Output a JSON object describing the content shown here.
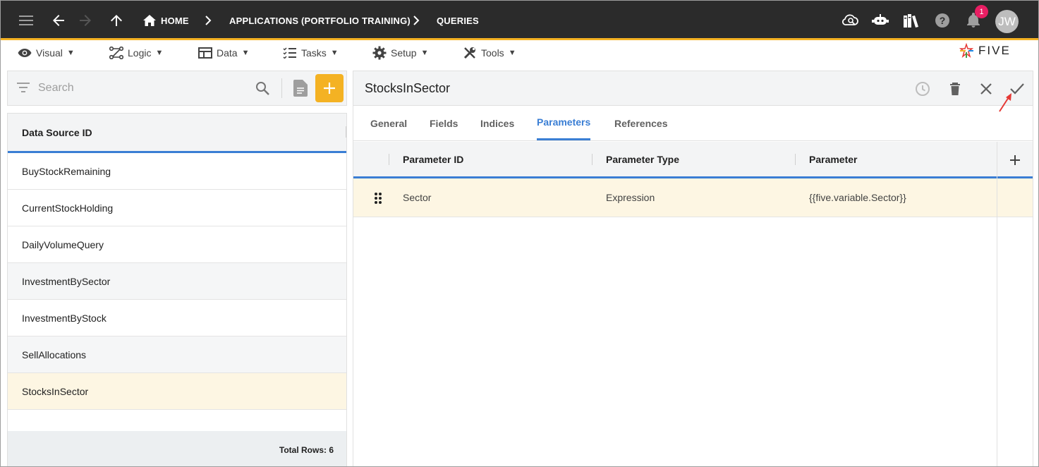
{
  "topbar": {
    "breadcrumbs": [
      "HOME",
      "APPLICATIONS (PORTFOLIO TRAINING)",
      "QUERIES"
    ],
    "notification_count": "1",
    "avatar_initials": "JW",
    "background_color": "#2b2b2b",
    "accent_color": "#f4b223",
    "icons": [
      "hamburger-menu-icon",
      "back-arrow-icon",
      "forward-arrow-icon",
      "up-arrow-icon",
      "home-icon",
      "cloud-search-icon",
      "chatbot-icon",
      "library-books-icon",
      "help-icon",
      "notification-bell-icon"
    ]
  },
  "menubar": {
    "items": [
      {
        "label": "Visual",
        "icon": "eye-icon"
      },
      {
        "label": "Logic",
        "icon": "logic-flow-icon"
      },
      {
        "label": "Data",
        "icon": "table-icon"
      },
      {
        "label": "Tasks",
        "icon": "checklist-icon"
      },
      {
        "label": "Setup",
        "icon": "gear-icon"
      },
      {
        "label": "Tools",
        "icon": "tools-icon"
      }
    ],
    "dropdown_glyph": "▼",
    "logo_text": "FIVE"
  },
  "left_panel": {
    "search_placeholder": "Search",
    "list_header": "Data Source ID",
    "rows": [
      "BuyStockRemaining",
      "CurrentStockHolding",
      "DailyVolumeQuery",
      "InvestmentBySector",
      "InvestmentByStock",
      "SellAllocations",
      "StocksInSector"
    ],
    "selected_row": "StocksInSector",
    "footer": "Total Rows: 6"
  },
  "form": {
    "title": "StocksInSector",
    "tabs": [
      "General",
      "Fields",
      "Indices",
      "Parameters",
      "References"
    ],
    "active_tab": "Parameters",
    "grid": {
      "columns": [
        "Parameter ID",
        "Parameter Type",
        "Parameter"
      ],
      "rows": [
        {
          "parameter_id": "Sector",
          "parameter_type": "Expression",
          "parameter": "{{five.variable.Sector}}"
        }
      ]
    },
    "accent_color": "#3a7ed4",
    "selected_row_color": "#fdf6e3"
  }
}
